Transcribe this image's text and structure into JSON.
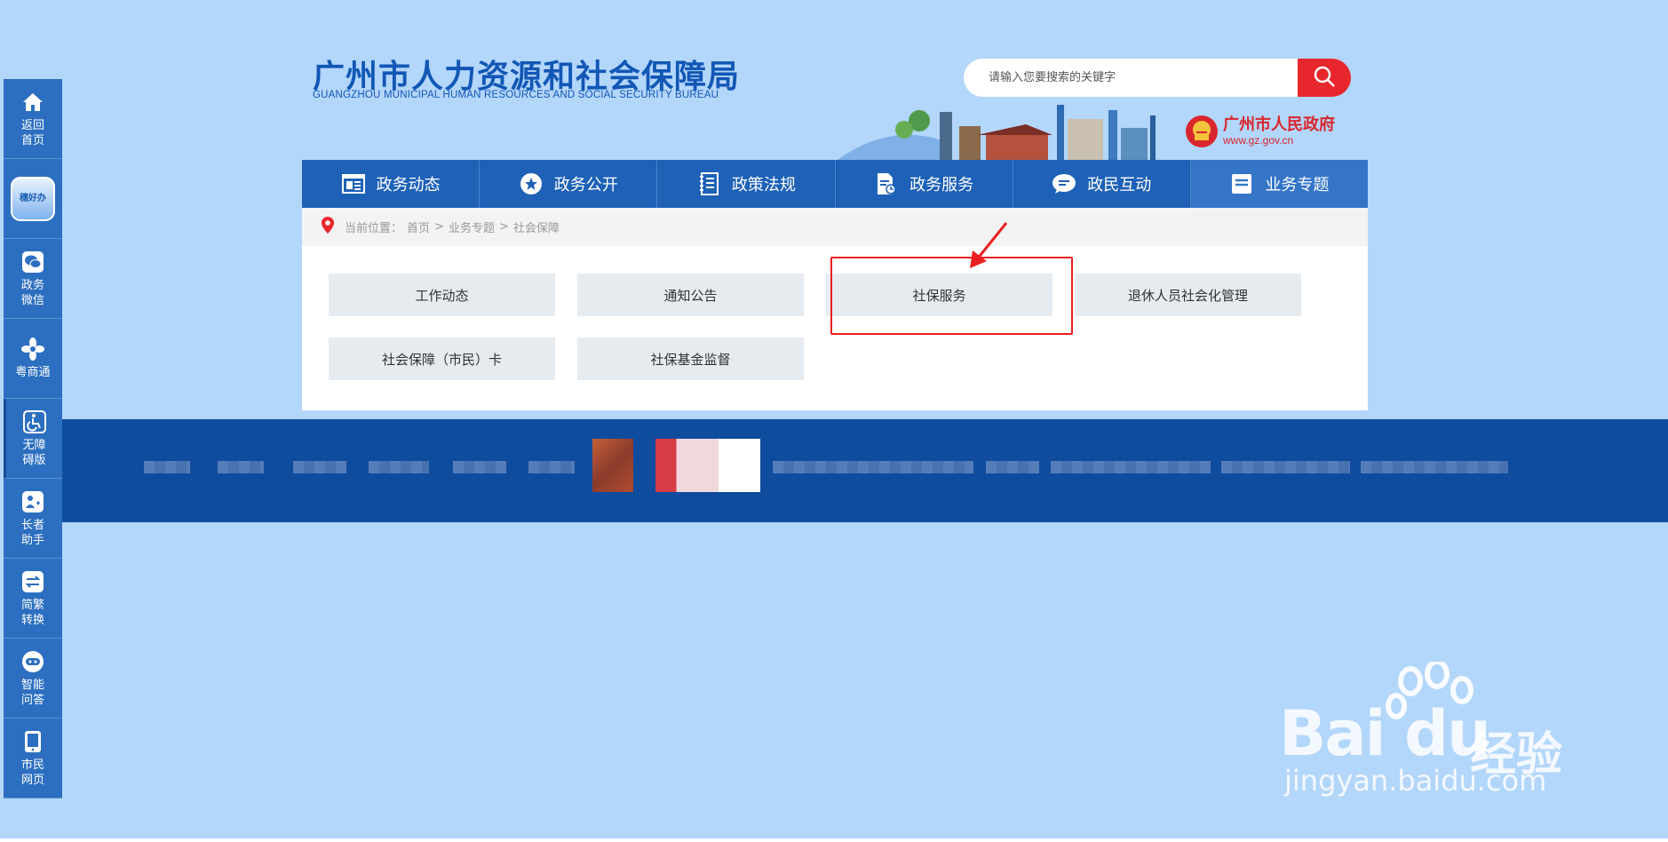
{
  "header": {
    "title": "广州市人力资源和社会保障局",
    "subtitle": "GUANGZHOU MUNICIPAL HUMAN RESOURCES AND SOCIAL SECURITY BUREAU",
    "search_placeholder": "请输入您要搜索的关键字",
    "gov_name": "广州市人民政府",
    "gov_url": "www.gz.gov.cn"
  },
  "sidebar": {
    "items": [
      {
        "label": "返回首页",
        "icon": "home-icon"
      },
      {
        "label": "穗好办",
        "icon": "app-icon"
      },
      {
        "label": "政务微信",
        "icon": "wechat-icon"
      },
      {
        "label": "粤商通",
        "icon": "flower-icon"
      },
      {
        "label": "无障碍版",
        "icon": "accessibility-icon"
      },
      {
        "label": "长者助手",
        "icon": "elder-icon"
      },
      {
        "label": "简繁转换",
        "icon": "switch-icon"
      },
      {
        "label": "智能问答",
        "icon": "robot-icon"
      },
      {
        "label": "市民网页",
        "icon": "tablet-icon"
      }
    ]
  },
  "nav": {
    "items": [
      {
        "label": "政务动态",
        "icon": "news-icon"
      },
      {
        "label": "政务公开",
        "icon": "star-icon"
      },
      {
        "label": "政策法规",
        "icon": "book-icon"
      },
      {
        "label": "政务服务",
        "icon": "document-icon"
      },
      {
        "label": "政民互动",
        "icon": "chat-icon"
      },
      {
        "label": "业务专题",
        "icon": "list-icon"
      }
    ]
  },
  "breadcrumb": {
    "prefix": "当前位置：",
    "items": [
      "首页",
      "业务专题",
      "社会保障"
    ],
    "sep": ">"
  },
  "tiles": [
    {
      "label": "工作动态"
    },
    {
      "label": "通知公告"
    },
    {
      "label": "社保服务"
    },
    {
      "label": "退休人员社会化管理"
    },
    {
      "label": "社会保障（市民）卡"
    },
    {
      "label": "社保基金监督"
    }
  ],
  "watermark": {
    "brand": "Bai du",
    "cn": "经验",
    "url": "jingyan.baidu.com"
  },
  "colors": {
    "background": "#b3d6fb",
    "nav": "#1e61b7",
    "brand_blue": "#1257b5",
    "search_red": "#e7272d",
    "highlight_red": "#e8201f",
    "footer": "#0f4c9e"
  }
}
